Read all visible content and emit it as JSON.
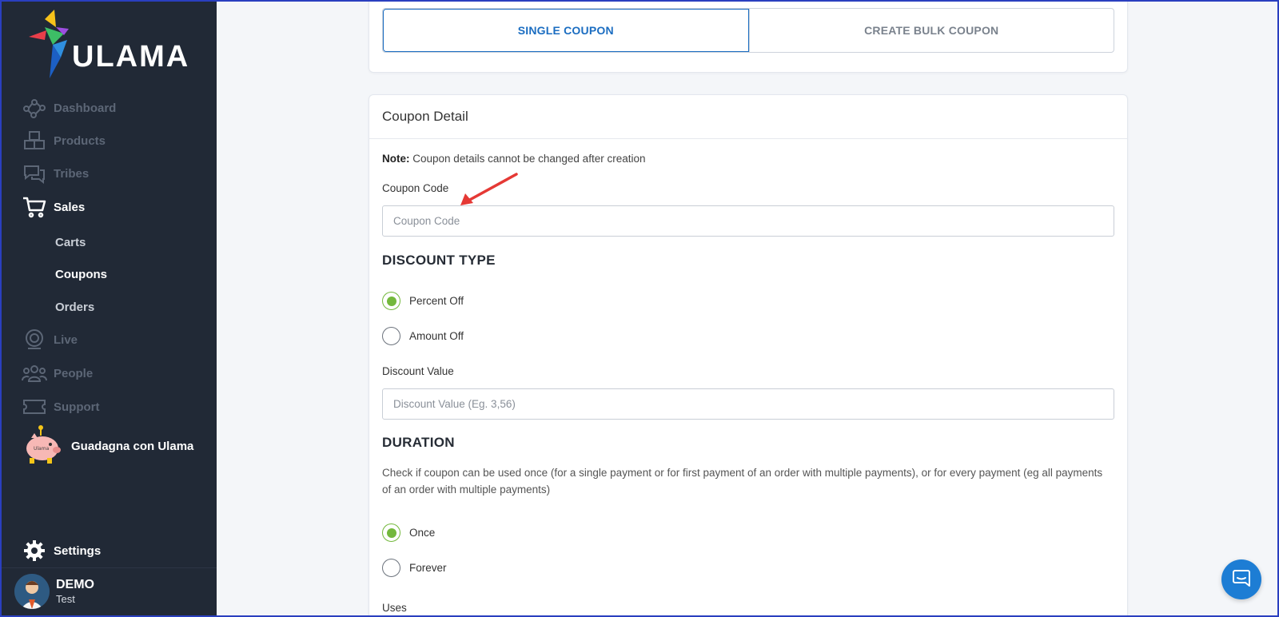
{
  "brand": {
    "name": "ULAMA"
  },
  "sidebar": {
    "items": [
      {
        "label": "Dashboard",
        "icon": "dashboard-icon"
      },
      {
        "label": "Products",
        "icon": "products-icon"
      },
      {
        "label": "Tribes",
        "icon": "tribes-icon"
      },
      {
        "label": "Sales",
        "icon": "cart-icon"
      },
      {
        "label": "Live",
        "icon": "live-icon"
      },
      {
        "label": "People",
        "icon": "people-icon"
      },
      {
        "label": "Support",
        "icon": "support-icon"
      }
    ],
    "sales_sub": [
      "Carts",
      "Coupons",
      "Orders"
    ],
    "promo_label": "Guadagna con Ulama",
    "settings_label": "Settings",
    "user": {
      "name": "DEMO",
      "subtitle": "Test"
    }
  },
  "tabs": {
    "single": "SINGLE COUPON",
    "bulk": "CREATE BULK COUPON"
  },
  "coupon": {
    "title": "Coupon Detail",
    "note_label": "Note:",
    "note_text": "Coupon details cannot be changed after creation",
    "code_label": "Coupon Code",
    "code_placeholder": "Coupon Code",
    "discount_type_title": "DISCOUNT TYPE",
    "discount_options": [
      "Percent Off",
      "Amount Off"
    ],
    "discount_value_label": "Discount Value",
    "discount_value_placeholder": "Discount Value (Eg. 3,56)",
    "duration_title": "DURATION",
    "duration_desc": "Check if coupon can be used once (for a single payment or for first payment of an order with multiple payments), or for every payment (eg all payments of an order with multiple payments)",
    "duration_options": [
      "Once",
      "Forever"
    ],
    "uses_label": "Uses"
  },
  "colors": {
    "sidebar_bg": "#212936",
    "accent_blue": "#1b6dc1",
    "radio_green": "#73b83c",
    "chat_blue": "#1d7dd4",
    "arrow_red": "#e53935"
  }
}
